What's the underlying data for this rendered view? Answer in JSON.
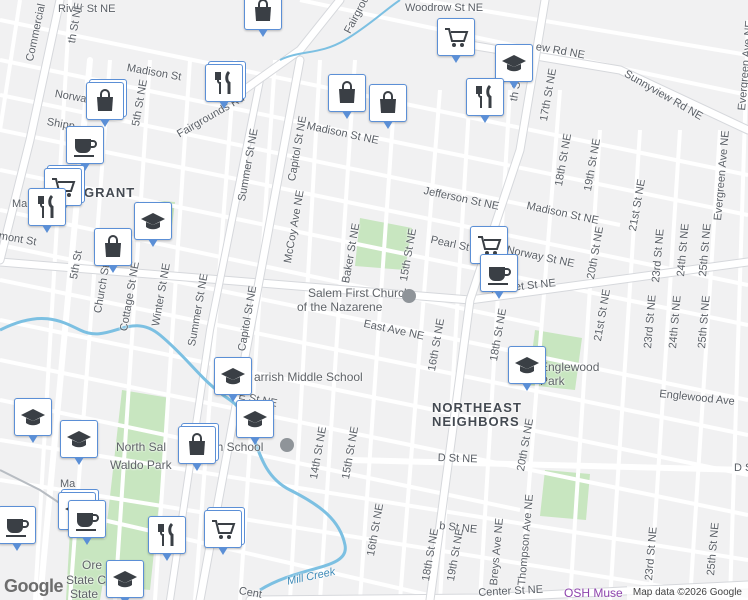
{
  "map": {
    "neighborhoods": [
      "GRANT",
      "NORTHEAST",
      "NEIGHBORS"
    ],
    "pois": [
      "Salem First Church of the Nazarene",
      "Parrish Middle School",
      "North Salem High School",
      "Waldo Park",
      "Englewood Park",
      "OSH Museum",
      "Oregon State Capitol"
    ],
    "waterway": "Mill Creek",
    "poi_split": {
      "church_line1": "Salem First Church",
      "church_line2": "of the Nazarene",
      "englewood1": "Englewood",
      "englewood2": "Park",
      "osh": "OSH Muse",
      "capitol1": "Ore",
      "capitol2": "State C",
      "capitol3": "State",
      "north_salem": "North Sal",
      "high_school": "gh School",
      "parrish": "arrish Middle School"
    },
    "streets": {
      "river": "River St NE",
      "woodrow": "Woodrow St NE",
      "fairgrounds": "Fairgrounds",
      "fairgrounds_rd": "Fairgrounds Rd",
      "madison_top": "Madison St",
      "madison": "Madison St NE",
      "madison_e": "Madison St NE",
      "sunnyview": "Sunnyview Rd NE",
      "sunnyview2": "ew Rd NE",
      "jefferson": "Jefferson St NE",
      "norway": "Norway St NE",
      "norway_w": "Norwa",
      "shipping": "Shipp",
      "pearl": "Pearl St",
      "market": "Market St NE",
      "east": "East Ave NE",
      "englewood": "Englewood Ave",
      "d_st": "D St NE",
      "d_st_e": "D St",
      "center": "Center St NE",
      "center_w": "Cent",
      "e_st": "E St NE",
      "e_st2": "d St NE",
      "b_st": "B St NE",
      "b_st_w": "th St NE",
      "commercial": "Commercial",
      "fifth": "5th St NE",
      "fifth_w": "5th St",
      "church": "Church St",
      "cottage": "Cottage St NE",
      "winter": "Winter St NE",
      "summer": "Summer St NE",
      "capitol": "Capitol St NE",
      "capitol_top": "Capitol St NE",
      "mccoy": "McCoy Ave NE",
      "baker": "Baker St NE",
      "fifteenth": "15th St NE",
      "fifteenth_s": "15th St NE",
      "fourteenth": "14th St NE",
      "sixteenth": "16th St NE",
      "sixteenth_s": "16th St NE",
      "seventeenth": "17th St NE",
      "eighteenth": "18th St NE",
      "eighteenth_s": "18th St NE",
      "eighteenth_top": "18th St NE",
      "nineteenth": "19th St NE",
      "nineteenth_top": "19th St NE",
      "nineteenth_n": "th St NE",
      "twentieth": "20th St NE",
      "twentieth_s": "20th St NE",
      "twentyfirst": "21st St NE",
      "twentyfirst_top": "21st St NE",
      "twentythird": "23rd St NE",
      "twentythird_s": "23rd St NE",
      "twentyfourth": "24th St NE",
      "twentyfifth": "25th St NE",
      "twentyfifth_s": "25th St NE",
      "evergreen": "Evergreen Ave NE",
      "evergreen2": "Evergreen Ave NE",
      "breys": "Breys Ave NE",
      "thompson": "Thompson Ave NE",
      "st_e": "d St NE",
      "grant_ma": "Ma",
      "mont": "mont St",
      "ma2": "Ma",
      "b_lbl": "b St NE",
      "grant_prefix": "E"
    },
    "pin_icons": [
      "shopping-cart",
      "graduation-cap",
      "fork-knife",
      "shopping-bag",
      "coffee-cup"
    ],
    "attribution": "Map data ©2026 Google",
    "logo": "Google",
    "colors": {
      "background": "#f1f1f2",
      "road": "#ffffff",
      "road_casing": "#d6d8dc",
      "park": "#c8e6c0",
      "water": "#7cc0e2",
      "pin_border": "#5b8fd6",
      "pin_icon": "#3a3f45"
    }
  }
}
